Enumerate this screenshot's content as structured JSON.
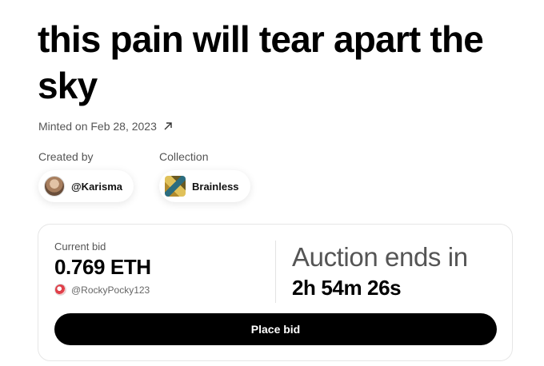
{
  "title": "this pain will tear apart the sky",
  "minted": {
    "text": "Minted on Feb 28, 2023",
    "icon": "arrow-up-right-icon"
  },
  "creator": {
    "label": "Created by",
    "handle": "@Karisma"
  },
  "collection": {
    "label": "Collection",
    "name": "Brainless"
  },
  "bid": {
    "label": "Current bid",
    "amount": "0.769 ETH",
    "bidder": "@RockyPocky123"
  },
  "auction": {
    "label": "Auction ends in",
    "time_left": "2h 54m 26s"
  },
  "actions": {
    "place_bid_label": "Place bid"
  },
  "colors": {
    "primary_button": "#000000",
    "secondary_text": "#555555"
  }
}
